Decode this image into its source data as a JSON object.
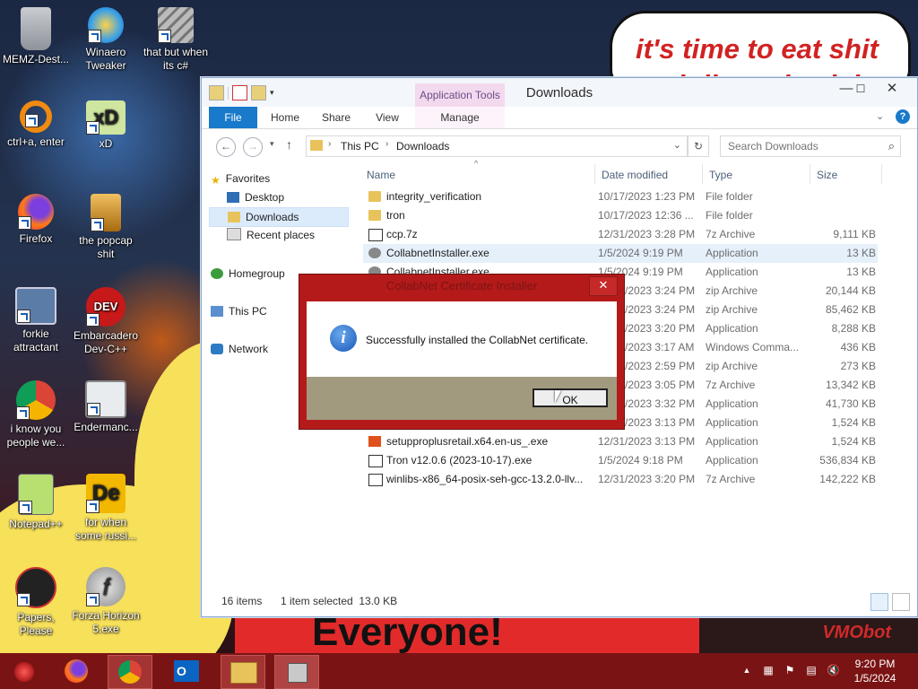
{
  "wallpaper": {
    "bubble_line1": "it's time to eat shit",
    "bubble_line2": "and die and celebrate",
    "banner_text": "Everyone!",
    "corner_text": "VMObot"
  },
  "desktop_icons": [
    {
      "label": "MEMZ-Dest...",
      "icon": "recycle-bin-icon"
    },
    {
      "label": "Winaero Tweaker",
      "icon": "winaero-tweaker-icon"
    },
    {
      "label": "that but when its c#",
      "icon": "stacked-windows-icon"
    },
    {
      "label": "ctrl+a, enter",
      "icon": "orange-ring-icon"
    },
    {
      "label": "xD",
      "icon": "hxd-icon"
    },
    {
      "label": "Firefox",
      "icon": "firefox-icon"
    },
    {
      "label": "the popcap shit",
      "icon": "popcap-icon"
    },
    {
      "label": "forkie attractant",
      "icon": "monitor-gear-icon"
    },
    {
      "label": "Embarcadero Dev-C++",
      "icon": "devcpp-icon"
    },
    {
      "label": "i know you people we...",
      "icon": "chrome-icon"
    },
    {
      "label": "Endermanc...",
      "icon": "app-window-icon"
    },
    {
      "label": "Notepad++",
      "icon": "notepad-plus-plus-icon"
    },
    {
      "label": "for when some russi...",
      "icon": "de-icon"
    },
    {
      "label": "Papers, Please",
      "icon": "papers-please-icon"
    },
    {
      "label": "Forza Horizon 5.exe",
      "icon": "flash-icon"
    }
  ],
  "explorer": {
    "title": "Downloads",
    "app_tools_label": "Application Tools",
    "tabs": [
      "File",
      "Home",
      "Share",
      "View",
      "Manage"
    ],
    "address_crumbs": [
      "This PC",
      "Downloads"
    ],
    "search_placeholder": "Search Downloads",
    "nav": {
      "favorites": "Favorites",
      "desktop": "Desktop",
      "downloads": "Downloads",
      "recent": "Recent places",
      "homegroup": "Homegroup",
      "this_pc": "This PC",
      "network": "Network"
    },
    "columns": [
      "Name",
      "Date modified",
      "Type",
      "Size"
    ],
    "files": [
      {
        "name": "integrity_verification",
        "date": "10/17/2023 1:23 PM",
        "type": "File folder",
        "size": "",
        "kind": "folder"
      },
      {
        "name": "tron",
        "date": "10/17/2023 12:36 ...",
        "type": "File folder",
        "size": "",
        "kind": "folder"
      },
      {
        "name": "ccp.7z",
        "date": "12/31/2023 3:28 PM",
        "type": "7z Archive",
        "size": "9,111 KB",
        "kind": "zip"
      },
      {
        "name": "CollabnetInstaller.exe",
        "date": "1/5/2024 9:19 PM",
        "type": "Application",
        "size": "13 KB",
        "kind": "exe",
        "selected": true
      },
      {
        "name": "CollabnetInstaller.exe",
        "date": "1/5/2024 9:19 PM",
        "type": "Application",
        "size": "13 KB",
        "kind": "exe"
      },
      {
        "name": "",
        "date": "12/31/2023 3:24 PM",
        "type": "zip Archive",
        "size": "20,144 KB",
        "kind": "zip"
      },
      {
        "name": "",
        "date": "12/31/2023 3:24 PM",
        "type": "zip Archive",
        "size": "85,462 KB",
        "kind": "zip"
      },
      {
        "name": "",
        "date": "12/31/2023 3:20 PM",
        "type": "Application",
        "size": "8,288 KB",
        "kind": "exe"
      },
      {
        "name": "",
        "date": "12/31/2023 3:17 AM",
        "type": "Windows Comma...",
        "size": "436 KB",
        "kind": "exe"
      },
      {
        "name": "",
        "date": "12/31/2023 2:59 PM",
        "type": "zip Archive",
        "size": "273 KB",
        "kind": "zip"
      },
      {
        "name": "",
        "date": "12/31/2023 3:05 PM",
        "type": "7z Archive",
        "size": "13,342 KB",
        "kind": "zip"
      },
      {
        "name": "",
        "date": "12/31/2023 3:32 PM",
        "type": "Application",
        "size": "41,730 KB",
        "kind": "exe"
      },
      {
        "name": "setupproplusretail.x64.en-us_(1).exe",
        "date": "12/31/2023 3:13 PM",
        "type": "Application",
        "size": "1,524 KB",
        "kind": "office"
      },
      {
        "name": "setupproplusretail.x64.en-us_.exe",
        "date": "12/31/2023 3:13 PM",
        "type": "Application",
        "size": "1,524 KB",
        "kind": "office"
      },
      {
        "name": "Tron v12.0.6 (2023-10-17).exe",
        "date": "1/5/2024 9:18 PM",
        "type": "Application",
        "size": "536,834 KB",
        "kind": "zip"
      },
      {
        "name": "winlibs-x86_64-posix-seh-gcc-13.2.0-llv...",
        "date": "12/31/2023 3:20 PM",
        "type": "7z Archive",
        "size": "142,222 KB",
        "kind": "zip"
      }
    ],
    "status": {
      "items": "16 items",
      "selected": "1 item selected  13.0 KB"
    }
  },
  "dialog": {
    "title": "CollabNet Certificate Installer",
    "message": "Successfully installed the CollabNet certificate.",
    "ok_label": "OK",
    "close_label": "✕"
  },
  "taskbar": {
    "time": "9:20 PM",
    "date": "1/5/2024",
    "apps": [
      "start-orb-icon",
      "firefox-icon",
      "chrome-icon",
      "outlook-icon",
      "file-explorer-icon",
      "installer-icon"
    ]
  }
}
